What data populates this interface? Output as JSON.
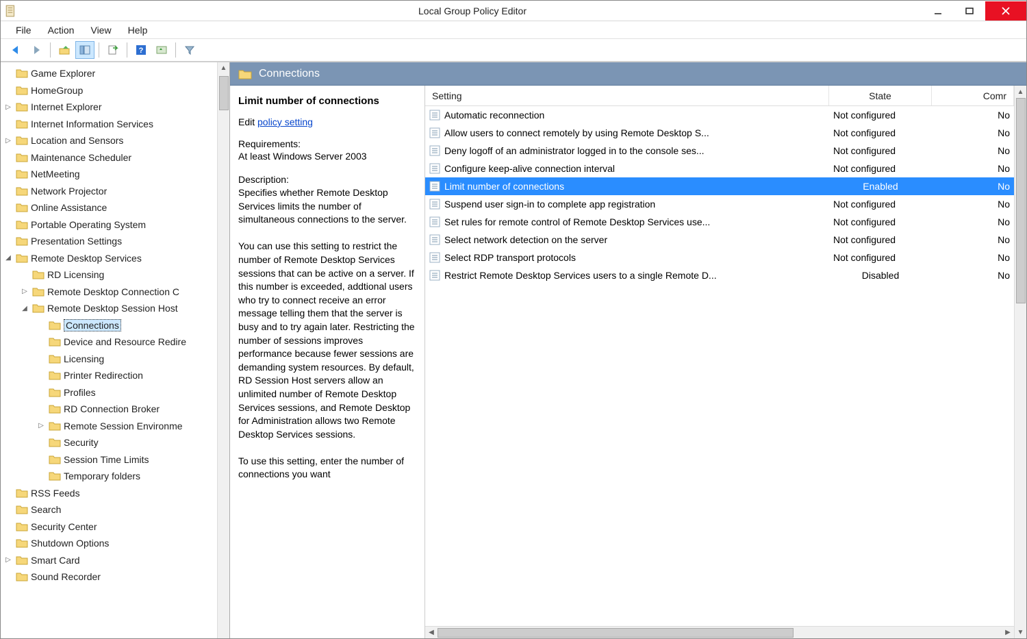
{
  "titlebar": {
    "title": "Local Group Policy Editor"
  },
  "menubar": [
    "File",
    "Action",
    "View",
    "Help"
  ],
  "section": {
    "title": "Connections"
  },
  "tree": [
    {
      "label": "Game Explorer",
      "indent": 1,
      "exp": ""
    },
    {
      "label": "HomeGroup",
      "indent": 1,
      "exp": ""
    },
    {
      "label": "Internet Explorer",
      "indent": 1,
      "exp": "▷"
    },
    {
      "label": "Internet Information Services",
      "indent": 1,
      "exp": ""
    },
    {
      "label": "Location and Sensors",
      "indent": 1,
      "exp": "▷"
    },
    {
      "label": "Maintenance Scheduler",
      "indent": 1,
      "exp": ""
    },
    {
      "label": "NetMeeting",
      "indent": 1,
      "exp": ""
    },
    {
      "label": "Network Projector",
      "indent": 1,
      "exp": ""
    },
    {
      "label": "Online Assistance",
      "indent": 1,
      "exp": ""
    },
    {
      "label": "Portable Operating System",
      "indent": 1,
      "exp": ""
    },
    {
      "label": "Presentation Settings",
      "indent": 1,
      "exp": ""
    },
    {
      "label": "Remote Desktop Services",
      "indent": 1,
      "exp": "◢"
    },
    {
      "label": "RD Licensing",
      "indent": 2,
      "exp": ""
    },
    {
      "label": "Remote Desktop Connection C",
      "indent": 2,
      "exp": "▷"
    },
    {
      "label": "Remote Desktop Session Host",
      "indent": 2,
      "exp": "◢"
    },
    {
      "label": "Connections",
      "indent": 3,
      "exp": "",
      "selected": true
    },
    {
      "label": "Device and Resource Redire",
      "indent": 3,
      "exp": ""
    },
    {
      "label": "Licensing",
      "indent": 3,
      "exp": ""
    },
    {
      "label": "Printer Redirection",
      "indent": 3,
      "exp": ""
    },
    {
      "label": "Profiles",
      "indent": 3,
      "exp": ""
    },
    {
      "label": "RD Connection Broker",
      "indent": 3,
      "exp": ""
    },
    {
      "label": "Remote Session Environme",
      "indent": 3,
      "exp": "▷"
    },
    {
      "label": "Security",
      "indent": 3,
      "exp": ""
    },
    {
      "label": "Session Time Limits",
      "indent": 3,
      "exp": ""
    },
    {
      "label": "Temporary folders",
      "indent": 3,
      "exp": ""
    },
    {
      "label": "RSS Feeds",
      "indent": 1,
      "exp": ""
    },
    {
      "label": "Search",
      "indent": 1,
      "exp": ""
    },
    {
      "label": "Security Center",
      "indent": 1,
      "exp": ""
    },
    {
      "label": "Shutdown Options",
      "indent": 1,
      "exp": ""
    },
    {
      "label": "Smart Card",
      "indent": 1,
      "exp": "▷"
    },
    {
      "label": "Sound Recorder",
      "indent": 1,
      "exp": ""
    }
  ],
  "desc": {
    "title": "Limit number of connections",
    "edit_prefix": "Edit ",
    "edit_link": "policy setting",
    "req_h": "Requirements:",
    "req": "At least Windows Server 2003",
    "desc_h": "Description:",
    "text1": "Specifies whether Remote Desktop Services limits the number of simultaneous connections to the server.",
    "text2": "You can use this setting to restrict the number of Remote Desktop Services sessions that can be active on a server. If this number is exceeded, addtional users who try to connect receive an error message telling them that the server is busy and to try again later. Restricting the number of sessions improves performance because fewer sessions are demanding system resources. By default, RD Session Host servers allow an unlimited number of Remote Desktop Services sessions, and Remote Desktop for Administration allows two Remote Desktop Services sessions.",
    "text3": "To use this setting, enter the number of connections you want"
  },
  "list": {
    "columns": {
      "setting": "Setting",
      "state": "State",
      "comment": "Comr"
    },
    "rows": [
      {
        "setting": "Automatic reconnection",
        "state": "Not configured",
        "comment": "No"
      },
      {
        "setting": "Allow users to connect remotely by using Remote Desktop S...",
        "state": "Not configured",
        "comment": "No"
      },
      {
        "setting": "Deny logoff of an administrator logged in to the console ses...",
        "state": "Not configured",
        "comment": "No"
      },
      {
        "setting": "Configure keep-alive connection interval",
        "state": "Not configured",
        "comment": "No"
      },
      {
        "setting": "Limit number of connections",
        "state": "Enabled",
        "comment": "No",
        "selected": true
      },
      {
        "setting": "Suspend user sign-in to complete app registration",
        "state": "Not configured",
        "comment": "No"
      },
      {
        "setting": "Set rules for remote control of Remote Desktop Services use...",
        "state": "Not configured",
        "comment": "No"
      },
      {
        "setting": "Select network detection on the server",
        "state": "Not configured",
        "comment": "No"
      },
      {
        "setting": "Select RDP transport protocols",
        "state": "Not configured",
        "comment": "No"
      },
      {
        "setting": "Restrict Remote Desktop Services users to a single Remote D...",
        "state": "Disabled",
        "comment": "No"
      }
    ]
  }
}
